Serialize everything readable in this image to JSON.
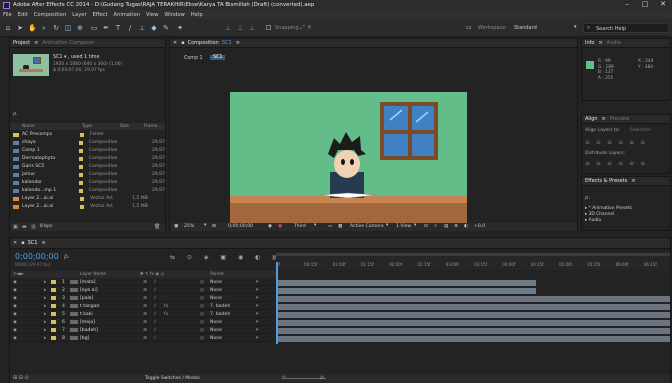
{
  "titlebar": {
    "title": "Adobe After Effects CC 2014 - D:\\Gudang Tugas\\RAJA TERAKHIR\\Ekse\\Karya TA Bismillah (Draft) (converted).aep",
    "min": "–",
    "max": "□",
    "close": "✕"
  },
  "menu": [
    "File",
    "Edit",
    "Composition",
    "Layer",
    "Effect",
    "Animation",
    "View",
    "Window",
    "Help"
  ],
  "toolbar": {
    "snapping": "Snapping",
    "workspace_label": "Workspace:",
    "workspace_value": "Standard",
    "search_placeholder": "Search Help"
  },
  "project": {
    "tab": "Project",
    "tab2": "Animation Composer",
    "comp_name": "SC1 ▾ , used 1 time",
    "comp_info1": "1920 x 1080  (640 x 360) (1,00)",
    "comp_info2": "Δ 0;00;07;00, 29,97 fps",
    "search_icon": "ρ.",
    "headers": [
      "Name",
      "Type",
      "Size",
      "Frame..."
    ],
    "items": [
      {
        "name": "AC Precomps",
        "type": "Folder",
        "size": "",
        "fps": "",
        "kind": "folder",
        "color": "#d8c060"
      },
      {
        "name": "chaya",
        "type": "Composition",
        "size": "",
        "fps": "29,97",
        "kind": "comp",
        "color": "#d8c060"
      },
      {
        "name": "Comp 1",
        "type": "Composition",
        "size": "",
        "fps": "29,97",
        "kind": "comp",
        "color": "#d8c060"
      },
      {
        "name": "Dermatophyta",
        "type": "Composition",
        "size": "",
        "fps": "29,97",
        "kind": "comp",
        "color": "#d8c060"
      },
      {
        "name": "Garis SC5",
        "type": "Composition",
        "size": "",
        "fps": "29,97",
        "kind": "comp",
        "color": "#d8c060"
      },
      {
        "name": "jamur",
        "type": "Composition",
        "size": "",
        "fps": "29,97",
        "kind": "comp",
        "color": "#d8c060"
      },
      {
        "name": "kalendar",
        "type": "Composition",
        "size": "",
        "fps": "29,97",
        "kind": "comp",
        "color": "#d8c060"
      },
      {
        "name": "kalenda...mp 1",
        "type": "Composition",
        "size": "",
        "fps": "29,97",
        "kind": "comp",
        "color": "#d8c060"
      },
      {
        "name": "Layer 2...ai.ai",
        "type": "Vector Art",
        "size": "1,5 MB",
        "fps": "",
        "kind": "ai",
        "color": "#d8c060"
      },
      {
        "name": "Layer 2...ai.ai",
        "type": "Vector Art",
        "size": "1,5 MB",
        "fps": "",
        "kind": "ai",
        "color": "#d8c060"
      }
    ],
    "bpc": "8 bpc"
  },
  "composition": {
    "tab": "Composition",
    "tab_comp": "SC1",
    "breadcrumb1": "Comp 1",
    "breadcrumb2": "SC1",
    "zoom": "25%",
    "timecode": "0;00;00;00",
    "resolution": "Third",
    "camera": "Active Camera",
    "view": "1 View",
    "offset": "+0,0"
  },
  "info": {
    "tab": "Info",
    "tab2": "Audio",
    "R": "R : 99",
    "G": "G : 189",
    "B": "B : 137",
    "A": "A : 255",
    "X": "X : 244",
    "Y": "Y : 384",
    "swatch": "#63bd89"
  },
  "align": {
    "tab": "Align",
    "tab2": "Preview",
    "align_to": "Align Layers to:",
    "align_value": "Selection",
    "distribute": "Distribute Layers:"
  },
  "effects": {
    "tab": "Effects & Presets",
    "items": [
      "* Animation Presets",
      "3D Channel",
      "Audio"
    ]
  },
  "timeline": {
    "tab": "SC1",
    "timecode": "0;00;00;00",
    "frames": "00000 (29.97 fps)",
    "toggle": "Toggle Switches / Modes",
    "ruler": [
      "0f",
      "00:15f",
      "01:00f",
      "01:15f",
      "02:00f",
      "02:15f",
      "03:00f",
      "03:15f",
      "04:00f",
      "04:15f",
      "05:00f",
      "05:15f",
      "06:00f",
      "06:15f"
    ],
    "headers": {
      "layer_name": "Layer Name",
      "parent": "Parent"
    },
    "layers": [
      {
        "num": "1",
        "name": "[mata]",
        "parent": "None",
        "color": "#d8c060",
        "bar_start": 0,
        "bar_end": 0.66
      },
      {
        "num": "2",
        "name": "[eye.ai]",
        "parent": "None",
        "color": "#d8c060",
        "bar_start": 0,
        "bar_end": 0.66
      },
      {
        "num": "3",
        "name": "[pala]",
        "parent": "None",
        "color": "#d8c060",
        "bar_start": 0,
        "bar_end": 1
      },
      {
        "num": "4",
        "name": "t tangan",
        "parent": "7. badeh",
        "color": "#d8c060",
        "bar_start": 0,
        "bar_end": 1
      },
      {
        "num": "5",
        "name": "t kaki",
        "parent": "7. badeh",
        "color": "#d8c060",
        "bar_start": 0,
        "bar_end": 1
      },
      {
        "num": "6",
        "name": "[meja]",
        "parent": "None",
        "color": "#d8c060",
        "bar_start": 0,
        "bar_end": 1
      },
      {
        "num": "7",
        "name": "[badeh]",
        "parent": "None",
        "color": "#d8c060",
        "bar_start": 0,
        "bar_end": 1
      },
      {
        "num": "8",
        "name": "[bg]",
        "parent": "None",
        "color": "#d8c060",
        "bar_start": 0,
        "bar_end": 1
      }
    ]
  }
}
